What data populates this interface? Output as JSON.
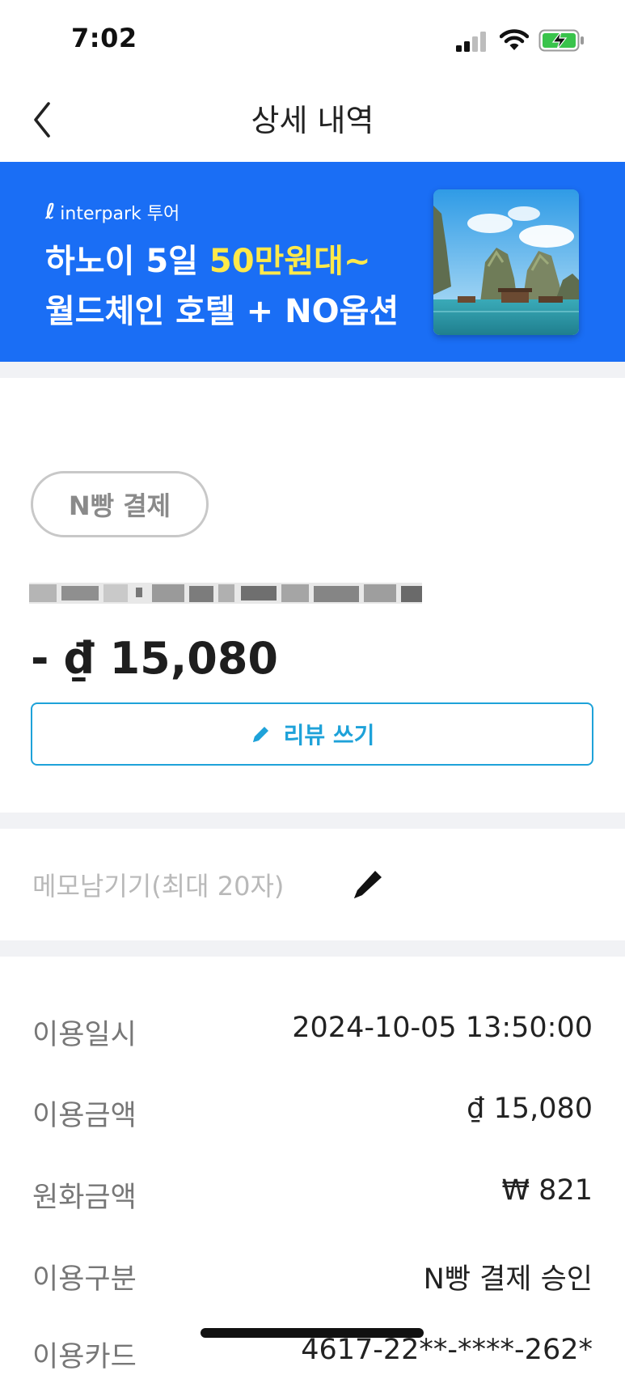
{
  "status_bar": {
    "time": "7:02"
  },
  "header": {
    "title": "상세 내역"
  },
  "banner": {
    "brand": "interpark 투어",
    "line1_prefix": "하노이 5일 ",
    "line1_highlight": "50만원대~",
    "line2": "월드체인 호텔 + NO옵션",
    "colors": {
      "background": "#1a6ef5",
      "highlight": "#ffe94a"
    }
  },
  "payment": {
    "badge": "N빵 결제",
    "amount": "- ₫ 15,080",
    "review_button": "리뷰 쓰기"
  },
  "memo": {
    "placeholder": "메모남기기(최대 20자)"
  },
  "details": [
    {
      "label": "이용일시",
      "value": "2024-10-05 13:50:00"
    },
    {
      "label": "이용금액",
      "value": "₫ 15,080"
    },
    {
      "label": "원화금액",
      "value": "₩ 821"
    },
    {
      "label": "이용구분",
      "value": "N빵 결제 승인"
    },
    {
      "label": "이용카드",
      "value": "4617-22**-****-262*"
    }
  ],
  "colors": {
    "accent": "#1ea2d9",
    "separator": "#f1f2f5"
  }
}
